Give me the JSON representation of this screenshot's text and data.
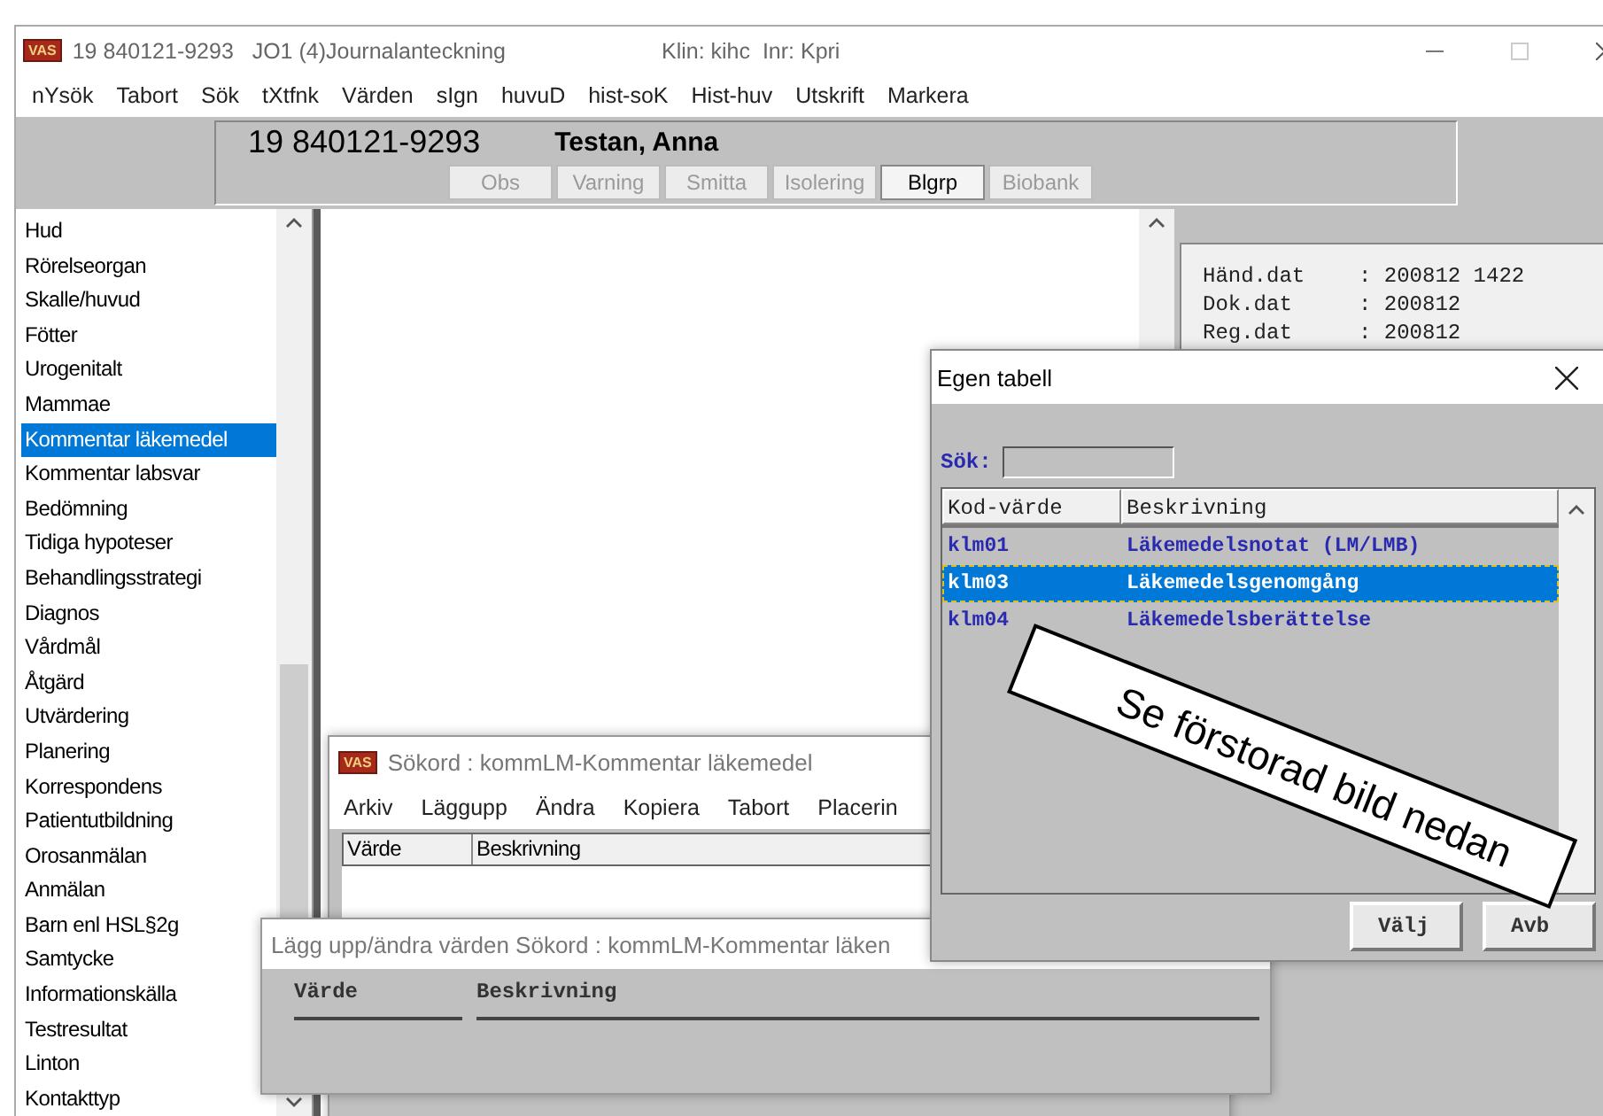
{
  "window": {
    "logo": "VAS",
    "title": "19 840121-9293   JO1 (4)Journalanteckning",
    "clinic": "Klin: kihc  Inr: Kpri"
  },
  "menu": [
    "nYsök",
    "Tabort",
    "Sök",
    "tXtfnk",
    "Värden",
    "sIgn",
    "huvuD",
    "hist-soK",
    "Hist-huv",
    "Utskrift",
    "Markera"
  ],
  "patient": {
    "id": "19 840121-9293",
    "name": "Testan, Anna",
    "flags": [
      {
        "label": "Obs",
        "disabled": true
      },
      {
        "label": "Varning",
        "disabled": true
      },
      {
        "label": "Smitta",
        "disabled": true
      },
      {
        "label": "Isolering",
        "disabled": true
      },
      {
        "label": "Blgrp",
        "disabled": false
      },
      {
        "label": "Biobank",
        "disabled": true
      }
    ]
  },
  "sections": [
    {
      "label": "Hud",
      "selected": false
    },
    {
      "label": "Rörelseorgan",
      "selected": false
    },
    {
      "label": "Skalle/huvud",
      "selected": false
    },
    {
      "label": "Fötter",
      "selected": false
    },
    {
      "label": "Urogenitalt",
      "selected": false
    },
    {
      "label": "Mammae",
      "selected": false
    },
    {
      "label": "Kommentar läkemedel",
      "selected": true
    },
    {
      "label": "Kommentar labsvar",
      "selected": false
    },
    {
      "label": "Bedömning",
      "selected": false
    },
    {
      "label": "Tidiga hypoteser",
      "selected": false
    },
    {
      "label": "Behandlingsstrategi",
      "selected": false
    },
    {
      "label": "Diagnos",
      "selected": false
    },
    {
      "label": "Vårdmål",
      "selected": false
    },
    {
      "label": "Åtgärd",
      "selected": false
    },
    {
      "label": "Utvärdering",
      "selected": false
    },
    {
      "label": "Planering",
      "selected": false
    },
    {
      "label": "Korrespondens",
      "selected": false
    },
    {
      "label": "Patientutbildning",
      "selected": false
    },
    {
      "label": "Orosanmälan",
      "selected": false
    },
    {
      "label": "Anmälan",
      "selected": false
    },
    {
      "label": "Barn enl HSL§2g",
      "selected": false
    },
    {
      "label": "Samtycke",
      "selected": false
    },
    {
      "label": "Informationskälla",
      "selected": false
    },
    {
      "label": "Testresultat",
      "selected": false
    },
    {
      "label": "Linton",
      "selected": false
    },
    {
      "label": "Kontakttyp",
      "selected": false
    }
  ],
  "info_lines": [
    {
      "label": "Händ.dat",
      "value": ": 200812 1422"
    },
    {
      "label": "Dok.dat",
      "value": ": 200812"
    },
    {
      "label": "Reg.dat",
      "value": ": 200812"
    }
  ],
  "sokord_window": {
    "logo": "VAS",
    "title": "Sökord : kommLM-Kommentar läkemedel",
    "menu": [
      "Arkiv",
      "Läggupp",
      "Ändra",
      "Kopiera",
      "Tabort",
      "Placerin"
    ],
    "columns": [
      "Värde",
      "Beskrivning"
    ]
  },
  "edit_window": {
    "title": "Lägg upp/ändra värden Sökord : kommLM-Kommentar läken",
    "columns": [
      "Värde",
      "Beskrivning"
    ]
  },
  "dialog": {
    "title": "Egen tabell",
    "search_label": "Sök:",
    "columns": [
      "Kod-värde",
      "Beskrivning"
    ],
    "rows": [
      {
        "code": "klm01",
        "description": "Läkemedelsnotat (LM/LMB)",
        "selected": false
      },
      {
        "code": "klm03",
        "description": "Läkemedelsgenomgång",
        "selected": true
      },
      {
        "code": "klm04",
        "description": "Läkemedelsberättelse",
        "selected": false
      }
    ],
    "buttons": [
      "Välj",
      "Avb"
    ]
  },
  "annotation": "Se förstorad bild nedan"
}
